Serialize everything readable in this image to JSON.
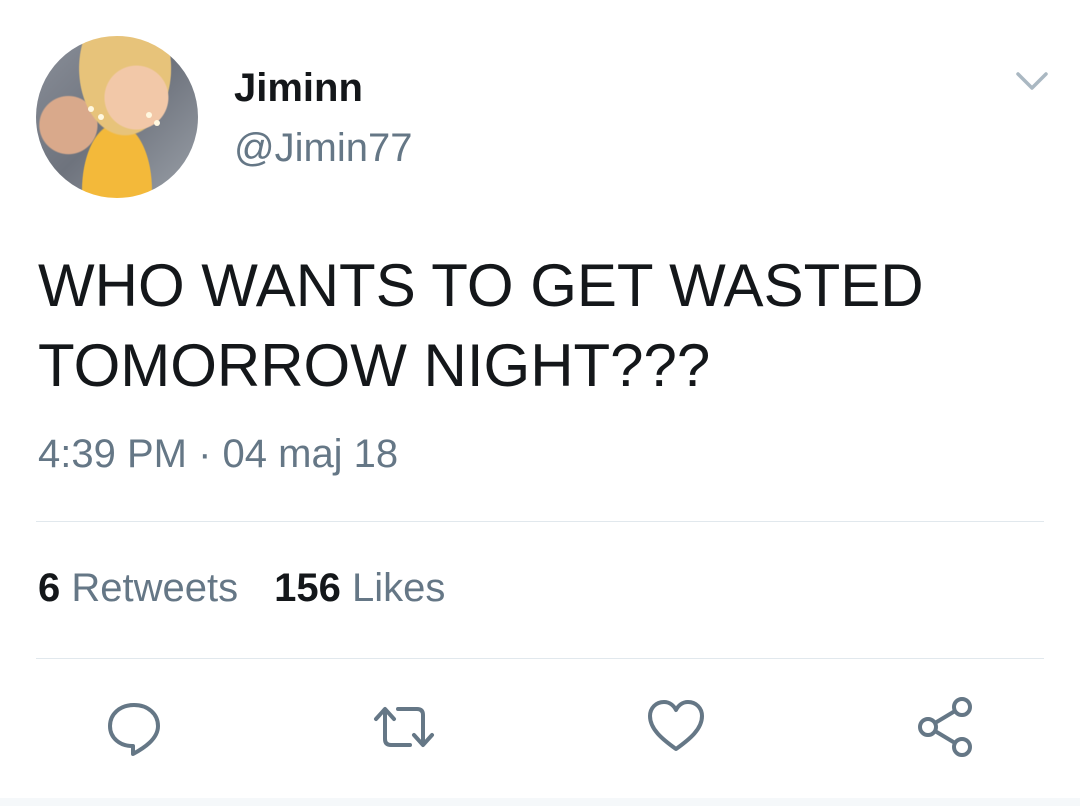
{
  "tweet": {
    "author": {
      "display_name": "Jiminn",
      "handle": "@Jimin77",
      "avatar_icon": "profile-photo"
    },
    "text": "WHO WANTS TO GET WASTED TOMORROW NIGHT???",
    "timestamp": "4:39 PM · 04 maj 18",
    "stats": {
      "retweets_count": "6",
      "retweets_label": "Retweets",
      "likes_count": "156",
      "likes_label": "Likes"
    },
    "actions": [
      {
        "name": "reply",
        "icon": "speech-bubble-icon"
      },
      {
        "name": "retweet",
        "icon": "retweet-arrows-icon"
      },
      {
        "name": "like",
        "icon": "heart-icon"
      },
      {
        "name": "share",
        "icon": "share-nodes-icon"
      }
    ]
  },
  "colors": {
    "text_primary": "#14171a",
    "text_secondary": "#657786",
    "divider": "#e1e8ed",
    "icon": "#657786",
    "background": "#ffffff"
  }
}
